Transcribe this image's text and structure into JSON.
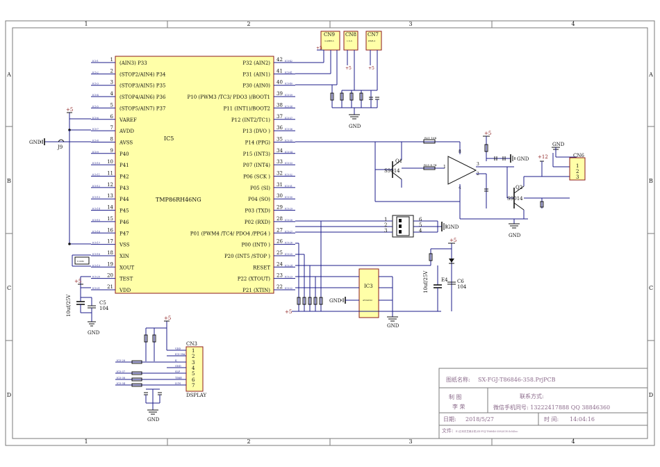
{
  "frame": {
    "cols": [
      "1",
      "2",
      "3",
      "4"
    ],
    "rows": [
      "A",
      "B",
      "C",
      "D"
    ]
  },
  "ic5": {
    "ref": "IC5",
    "part": "TMP86RH46NG",
    "left_pins": [
      {
        "num": "1",
        "name": "(AIN3) P33",
        "net": "IC5-1"
      },
      {
        "num": "2",
        "name": "(STOP2/AIN4) P34",
        "net": "IC5-2"
      },
      {
        "num": "3",
        "name": "(STOP3/AIN5) P35",
        "net": "IC5-3"
      },
      {
        "num": "4",
        "name": "(STOP4/AIN6) P36",
        "net": "IC5-4"
      },
      {
        "num": "5",
        "name": "(STOP5/AIN7) P37",
        "net": "IC5-5"
      },
      {
        "num": "6",
        "name": "VAREF",
        "net": "IC5-6"
      },
      {
        "num": "7",
        "name": "AVDD",
        "net": "IC5-7"
      },
      {
        "num": "8",
        "name": "AVSS",
        "net": "IC5-8"
      },
      {
        "num": "9",
        "name": "P40",
        "net": "IC5-9"
      },
      {
        "num": "10",
        "name": "P41",
        "net": "IC5-10"
      },
      {
        "num": "11",
        "name": "P42",
        "net": "IC5-11"
      },
      {
        "num": "12",
        "name": "P43",
        "net": "IC5-12"
      },
      {
        "num": "13",
        "name": "P44",
        "net": "IC5-13"
      },
      {
        "num": "14",
        "name": "P45",
        "net": "IC5-14"
      },
      {
        "num": "15",
        "name": "P46",
        "net": "IC5-15"
      },
      {
        "num": "16",
        "name": "P47",
        "net": "IC5-16"
      },
      {
        "num": "17",
        "name": "VSS",
        "net": "IC5-17"
      },
      {
        "num": "18",
        "name": "XIN",
        "net": "IC5-18"
      },
      {
        "num": "19",
        "name": "XOUT",
        "net": "IC5-19"
      },
      {
        "num": "20",
        "name": "TEST",
        "net": "IC5-20"
      },
      {
        "num": "21",
        "name": "VDD",
        "net": "IC5-21"
      }
    ],
    "right_pins": [
      {
        "num": "42",
        "name": "P32 (AIN2)",
        "net": "IC5-42"
      },
      {
        "num": "41",
        "name": "P31 (AIN1)",
        "net": "IC5-41"
      },
      {
        "num": "40",
        "name": "P30 (AIN0)",
        "net": "IC5-40"
      },
      {
        "num": "39",
        "name": "P10 (PWM3 /TC3/ PDO3 )/BOOT1",
        "net": "IC5-39"
      },
      {
        "num": "38",
        "name": "P11 (INT1)/BOOT2",
        "net": "IC5-38"
      },
      {
        "num": "37",
        "name": "P12 (INT2/TC1)",
        "net": "IC5-37"
      },
      {
        "num": "36",
        "name": "P13 (DVO )",
        "net": "IC5-36"
      },
      {
        "num": "35",
        "name": "P14 (PPG)",
        "net": "IC5-35"
      },
      {
        "num": "34",
        "name": "P15 (INT3)",
        "net": "IC5-34"
      },
      {
        "num": "33",
        "name": "P07 (INT4)",
        "net": "IC5-33"
      },
      {
        "num": "32",
        "name": "P06 (SCK )",
        "net": "IC5-32"
      },
      {
        "num": "31",
        "name": "P05 (SI)",
        "net": "IC5-31"
      },
      {
        "num": "30",
        "name": "P04 (SO)",
        "net": "IC5-30"
      },
      {
        "num": "29",
        "name": "P03 (TXD)",
        "net": "IC5-29"
      },
      {
        "num": "28",
        "name": "P02 (RXD)",
        "net": "IC5-28"
      },
      {
        "num": "27",
        "name": "P01 (PWM4 /TC4/ PDO4 /PPG4 )",
        "net": "IC5-27"
      },
      {
        "num": "26",
        "name": "P00 (INT0 )",
        "net": "IC5-26"
      },
      {
        "num": "25",
        "name": "P20 (INT5 /STOP )",
        "net": "IC5-25"
      },
      {
        "num": "24",
        "name": "RESET",
        "net": "IC5-24"
      },
      {
        "num": "23",
        "name": "P22 (XTOUT)",
        "net": "IC5-23"
      },
      {
        "num": "22",
        "name": "P21 (XTIN)",
        "net": "IC5-22"
      }
    ]
  },
  "labels": {
    "gnd": "GND",
    "plus5": "+5",
    "plus12": "+12",
    "j9": "J9",
    "cn9": "CN9",
    "cn8": "CN8",
    "cn7": "CN7",
    "cn9_sub": "3.0/HR-3",
    "cn8_sub": "1.5-3",
    "cn7_sub": "PWR-3",
    "cn6": "CN6",
    "cn3": "CN3",
    "cn3_sub": "DSPLAY",
    "ic3": "IC3",
    "ic3_part": "AT24C02",
    "q1": "Q1",
    "q1_part": "S9014",
    "q2": "Q2",
    "q2_part": "S9014",
    "c5": "C5",
    "c5_val": "104",
    "c5_rating": "10uf/25V",
    "e4": "E4",
    "e4_rating": "10uf/25V",
    "c6": "C6",
    "c6_val": "104",
    "xtal": "8.00M",
    "r21": "R21 10K",
    "r25": "R25 4.7K",
    "cn6_pins": [
      "1",
      "2",
      "3"
    ],
    "cn3_pins": [
      "1",
      "2",
      "3",
      "4",
      "5",
      "6",
      "7"
    ],
    "cn3_nets": [
      "VDD",
      "IC5-39A",
      "K",
      "GND",
      "SLP",
      "TIME",
      "LUN"
    ],
    "cn3_left_nets": [
      "IC5-28",
      "IC5-37",
      "IC5-38",
      "IC5-34"
    ],
    "switch_pins_left": [
      "1",
      "2",
      "3"
    ],
    "switch_pins_right": [
      "6",
      "5",
      "4"
    ],
    "opamp_pins": [
      "3",
      "2",
      "1",
      "8",
      "4"
    ]
  },
  "title_block": {
    "drawing_label": "图纸名称:",
    "drawing_name": "SX-FGJ-T86846-358.PrjPCB",
    "made_label": "制  图",
    "author": "李  荣",
    "contact_label": "联系方式:",
    "contact": "微信手机同号: 13222417888 QQ 38846360",
    "date_label": "日期:",
    "date": "2018/5/27",
    "time_label": "时 间:",
    "time": "14:04:16",
    "file_label": "文件:",
    "file": "E:\\日本东芝单片机\\SX-FGJ-T86846-358\\SCH.SchDoc"
  }
}
